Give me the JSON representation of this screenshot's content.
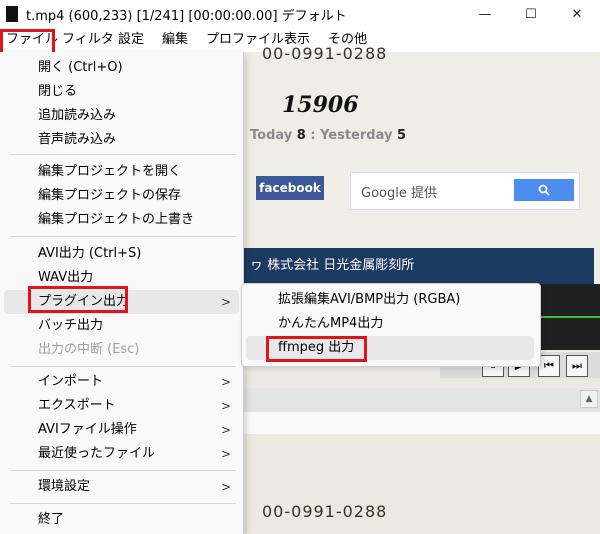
{
  "window": {
    "title": "t.mp4 (600,233)  [1/241] [00:00:00.00] デフォルト",
    "minimize": "—",
    "maximize": "☐",
    "close": "✕"
  },
  "menubar": {
    "items": [
      "ファイル",
      "フィルタ",
      "設定",
      "編集",
      "プロファイル",
      "表示",
      "その他"
    ]
  },
  "file_menu": {
    "items": [
      {
        "label": "開く (Ctrl+O)"
      },
      {
        "label": "閉じる"
      },
      {
        "label": "追加読み込み"
      },
      {
        "label": "音声読み込み"
      },
      {
        "label": "編集プロジェクトを開く"
      },
      {
        "label": "編集プロジェクトの保存"
      },
      {
        "label": "編集プロジェクトの上書き"
      },
      {
        "label": "AVI出力 (Ctrl+S)"
      },
      {
        "label": "WAV出力"
      },
      {
        "label": "プラグイン出力",
        "submenu_arrow": ">"
      },
      {
        "label": "バッチ出力"
      },
      {
        "label": "出力の中断 (Esc)",
        "disabled": true
      },
      {
        "label": "インポート",
        "submenu_arrow": ">"
      },
      {
        "label": "エクスポート",
        "submenu_arrow": ">"
      },
      {
        "label": "AVIファイル操作",
        "submenu_arrow": ">"
      },
      {
        "label": "最近使ったファイル",
        "submenu_arrow": ">"
      },
      {
        "label": "環境設定",
        "submenu_arrow": ">"
      },
      {
        "label": "終了"
      }
    ]
  },
  "plugin_submenu": {
    "items": [
      {
        "label": "拡張編集AVI/BMP出力 (RGBA)"
      },
      {
        "label": "かんたんMP4出力"
      },
      {
        "label": "ffmpeg 出力"
      }
    ]
  },
  "video_preview": {
    "phone": "00-0991-0288",
    "counter": "15906",
    "today_label": "Today",
    "today_value": "8",
    "yesterday_label": ": Yesterday",
    "yesterday_value": "5",
    "facebook": "facebook",
    "google_label": "Google 提供",
    "banner": "ヮ 株式会社 日光金属彫刻所"
  },
  "controls": [
    "⏸",
    "▶",
    "⏮",
    "⏭"
  ],
  "colors": {
    "highlight": "#e0141a",
    "facebook": "#3b5998",
    "search_button": "#4d8df0",
    "banner": "#1d3a62"
  }
}
